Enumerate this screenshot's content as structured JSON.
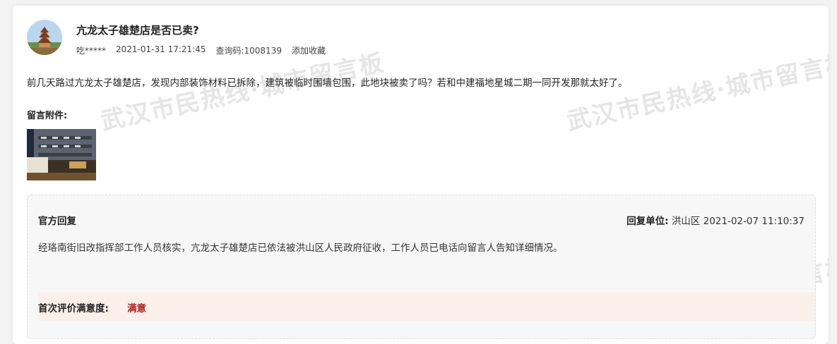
{
  "post": {
    "title": "亢龙太子雄楚店是否已卖?",
    "author": "吃*****",
    "datetime": "2021-01-31 17:21:45",
    "query_label": "查询码:",
    "query_code": "1008139",
    "favorite_label": "添加收藏",
    "content": "前几天路过亢龙太子雄楚店，发现内部装饰材料已拆除，建筑被临时围墙包围，此地块被卖了吗？若和中建福地星城二期一同开发那就太好了。",
    "attachment_label": "留言附件:"
  },
  "reply": {
    "title": "官方回复",
    "unit_label": "回复单位:",
    "unit": "洪山区",
    "datetime": "2021-02-07 11:10:37",
    "content": "经珞南街旧改指挥部工作人员核实，亢龙太子雄楚店已依法被洪山区人民政府征收，工作人员已电话向留言人告知详细情况。"
  },
  "evaluation": {
    "label": "首次评价满意度:",
    "value": "满意",
    "value_color": "#b21e1e"
  },
  "watermark": {
    "text": "武汉市民热线·城市留言板"
  }
}
